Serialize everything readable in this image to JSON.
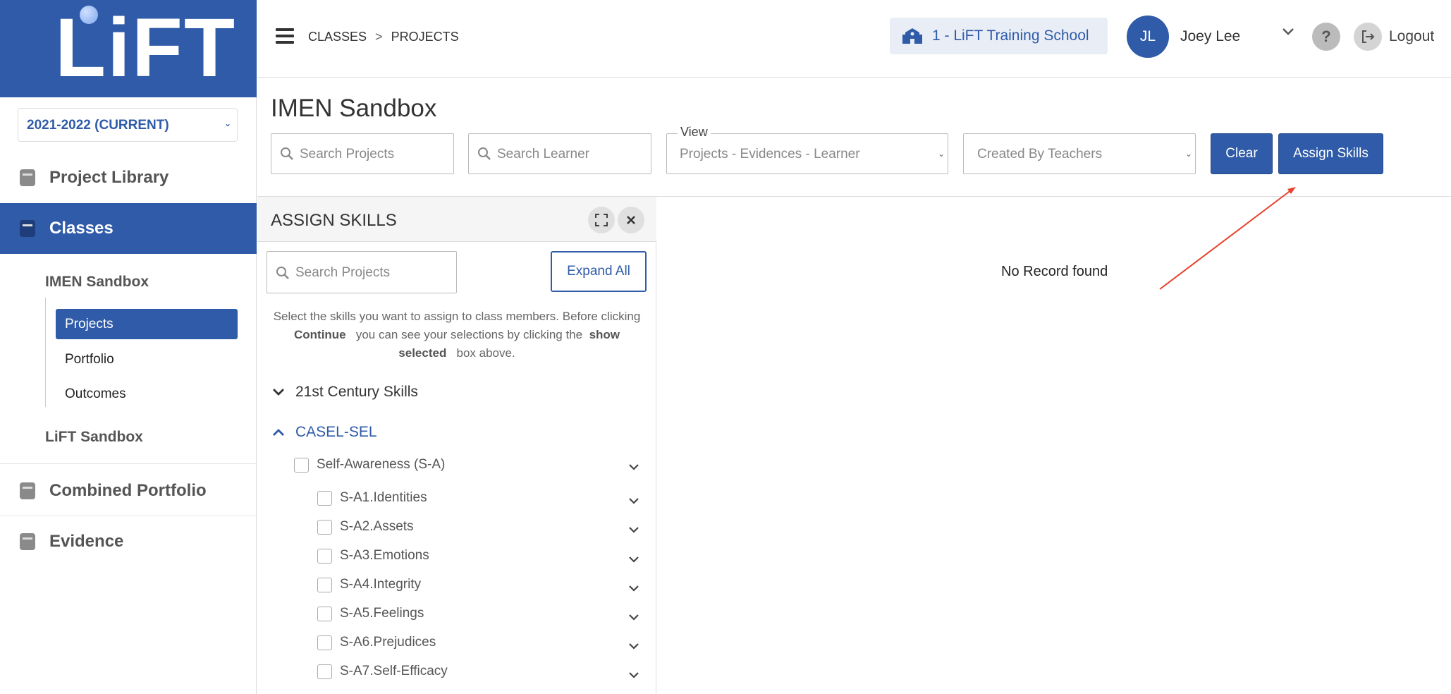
{
  "sidebar": {
    "logo": "LiFT",
    "year": "2021-2022 (CURRENT)",
    "nav": [
      {
        "label": "Project Library"
      },
      {
        "label": "Classes"
      },
      {
        "label": "Combined Portfolio"
      },
      {
        "label": "Evidence"
      }
    ],
    "classes": [
      {
        "name": "IMEN Sandbox",
        "items": [
          "Projects",
          "Portfolio",
          "Outcomes"
        ]
      },
      {
        "name": "LiFT Sandbox"
      }
    ]
  },
  "header": {
    "breadcrumb": [
      "CLASSES",
      "PROJECTS"
    ],
    "breadcrumb_sep": ">",
    "school": "1 - LiFT Training School",
    "user_initials": "JL",
    "user_name": "Joey Lee",
    "help": "?",
    "logout": "Logout"
  },
  "main": {
    "title": "IMEN Sandbox",
    "search_projects_placeholder": "Search Projects",
    "search_learner_placeholder": "Search Learner",
    "view_legend": "View",
    "view_value": "Projects - Evidences - Learner",
    "created_by_value": "Created By Teachers",
    "clear_label": "Clear",
    "assign_label": "Assign Skills",
    "no_record": "No Record found"
  },
  "panel": {
    "title": "ASSIGN SKILLS",
    "search_placeholder": "Search Projects",
    "expand_label": "Expand All",
    "instr_a": "Select the skills you want to assign to class members. Before clicking",
    "instr_continue": "Continue",
    "instr_b": "you can see your selections by clicking the",
    "instr_show": "show",
    "instr_selected": "selected",
    "instr_c": "box above.",
    "categories": [
      {
        "label": "21st Century Skills",
        "open": false
      },
      {
        "label": "CASEL-SEL",
        "open": true
      }
    ],
    "group": "Self-Awareness (S-A)",
    "skills": [
      "S-A1.Identities",
      "S-A2.Assets",
      "S-A3.Emotions",
      "S-A4.Integrity",
      "S-A5.Feelings",
      "S-A6.Prejudices",
      "S-A7.Self-Efficacy"
    ]
  },
  "colors": {
    "brand": "#2f5ba8",
    "annotation_arrow": "#e8412c"
  }
}
